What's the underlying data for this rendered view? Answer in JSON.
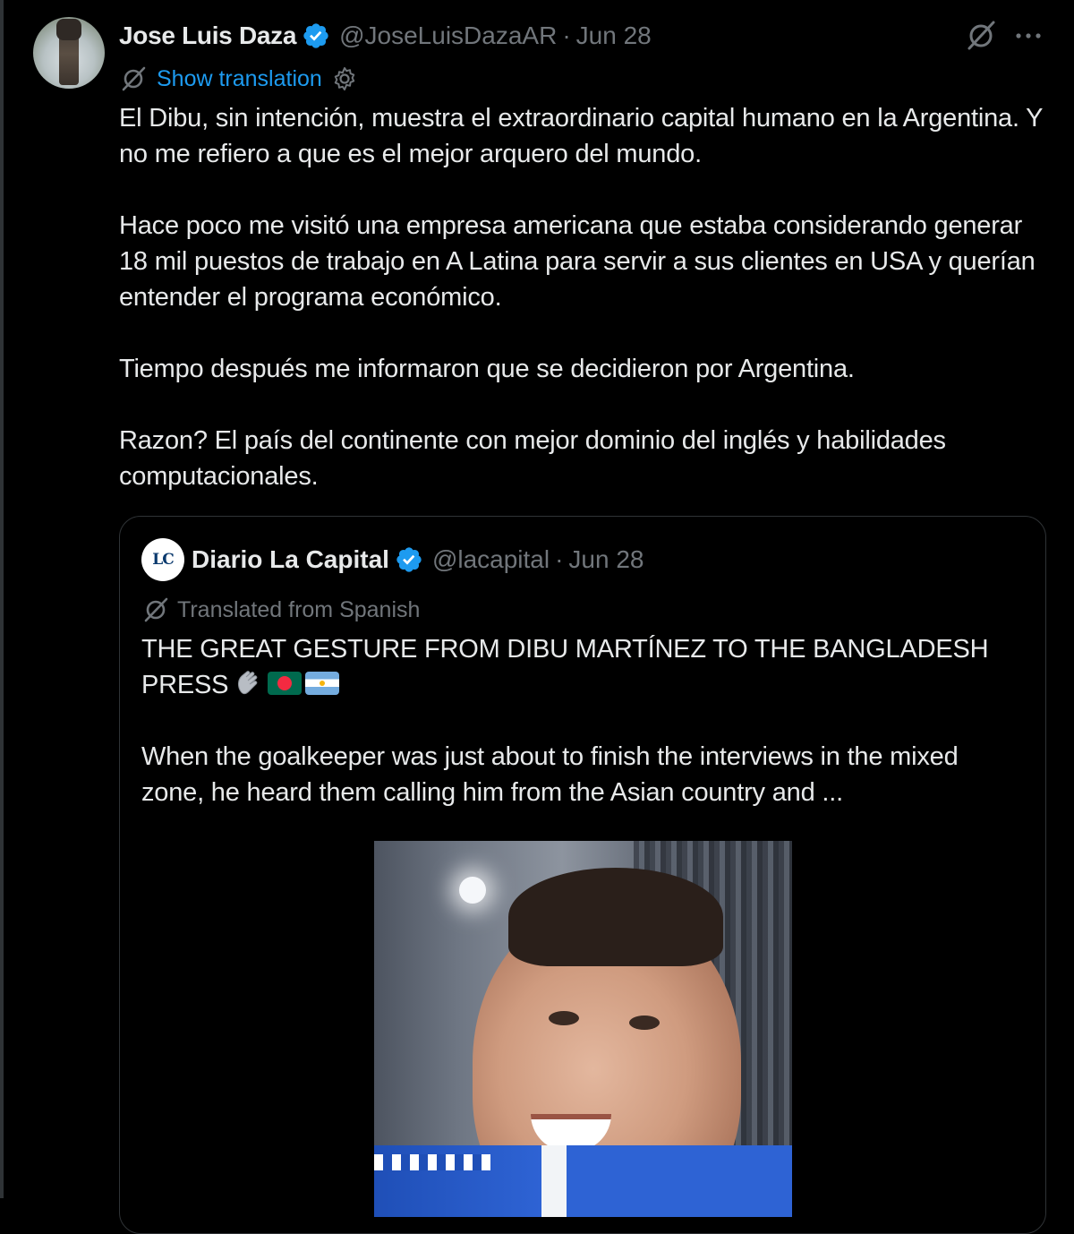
{
  "tweet": {
    "author_name": "Jose Luis Daza",
    "handle": "@JoseLuisDazaAR",
    "separator": "·",
    "date": "Jun 28",
    "show_translation": "Show translation",
    "body": "El Dibu, sin intención, muestra el extraordinario capital humano en la Argentina. Y no me refiero a que es el mejor arquero del mundo.\n\nHace poco me visitó una empresa americana que estaba considerando generar 18 mil puestos de trabajo en A Latina para servir a sus clientes en USA y querían entender el programa económico.\n\nTiempo después me informaron que se decidieron por Argentina.\n\nRazon? El país del continente con mejor dominio del inglés y habilidades computacionales."
  },
  "quote": {
    "avatar_text": "LC",
    "author_name": "Diario La Capital",
    "handle": "@lacapital",
    "separator": "·",
    "date": "Jun 28",
    "translated_label": "Translated from Spanish",
    "title": "THE GREAT GESTURE FROM DIBU MARTÍNEZ TO THE BANGLADESH PRESS",
    "emojis": [
      "clapping-hands",
      "flag-bangladesh",
      "flag-argentina"
    ],
    "paragraph": "When the goalkeeper was just about to finish the interviews in the mixed zone, he heard them calling him from the Asian country and ..."
  },
  "colors": {
    "background": "#000000",
    "text": "#e7e9ea",
    "muted": "#71767b",
    "link": "#1d9bf0",
    "verified": "#1d9bf0",
    "border": "#2f3336"
  },
  "icons": {
    "verified": "verified-badge-icon",
    "grok": "grok-icon",
    "more": "more-icon",
    "translate": "translate-icon",
    "settings": "gear-icon"
  }
}
